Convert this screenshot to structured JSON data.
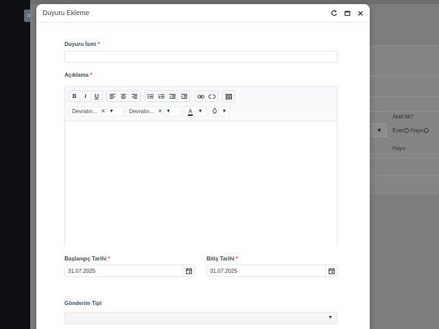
{
  "background": {
    "column_header": "Aktif Mi?",
    "radio_yes": "Evet",
    "radio_no": "Hayır",
    "row_value": "Hayır"
  },
  "modal": {
    "title": "Duyuru Ekleme",
    "icons": [
      "refresh-icon",
      "maximize-icon",
      "close-icon"
    ]
  },
  "form": {
    "name_label": "Duyuru İsmi",
    "name_value": "",
    "description_label": "Açıklama",
    "required_mark": "*",
    "toolbar": {
      "bold": "B",
      "italic": "I",
      "underline": "U",
      "font_family": "Devralın...",
      "font_size": "Devralın...",
      "font_color_glyph": "A"
    },
    "start_date_label": "Başlangıç Tarihi",
    "start_date_value": "31.07.2025",
    "end_date_label": "Bitiş Tarihi",
    "end_date_value": "31.07.2025",
    "send_type_label": "Gönderim Tipi",
    "send_type_value": ""
  }
}
